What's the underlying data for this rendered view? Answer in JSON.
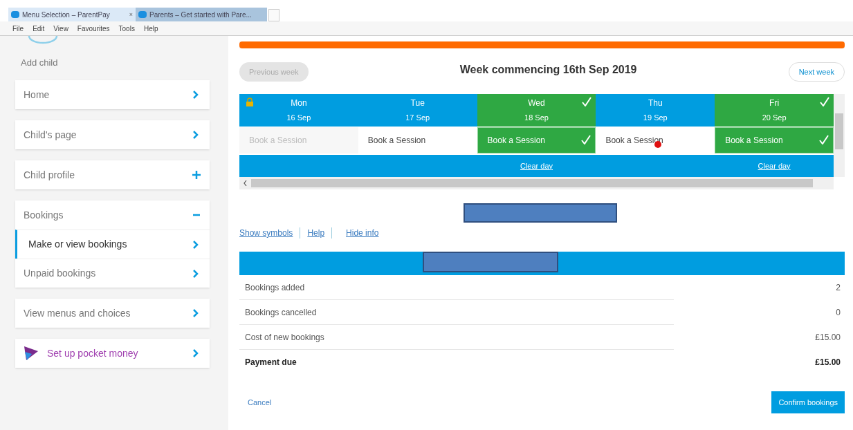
{
  "browser": {
    "tabs": [
      {
        "title": "Menu Selection – ParentPay",
        "selected": true,
        "close": "×"
      },
      {
        "title": "Parents – Get started with Pare...",
        "selected": false
      }
    ],
    "menu": [
      "File",
      "Edit",
      "View",
      "Favourites",
      "Tools",
      "Help"
    ]
  },
  "sidebar": {
    "add_child": "Add child",
    "items": [
      {
        "label": "Home",
        "selected": false
      },
      {
        "label": "Child's page",
        "selected": false
      },
      {
        "label": "Child profile",
        "selected": false,
        "expanded": false
      },
      {
        "label": "Bookings",
        "selected": false,
        "expanded": true,
        "children": [
          {
            "label": "Make or view bookings",
            "selected": true
          },
          {
            "label": "Unpaid bookings",
            "selected": false
          }
        ]
      },
      {
        "label": "View menus and choices",
        "selected": false
      },
      {
        "label": "Set up pocket money",
        "selected": false,
        "kind": "promo"
      }
    ]
  },
  "progress": {
    "level": 1
  },
  "week": {
    "previous": "Previous week",
    "title": "Week commencing 16th Sep 2019",
    "next": "Next week",
    "previous_disabled": true
  },
  "days": [
    {
      "day": "Mon",
      "date": "16 Sep",
      "session": "Book a Session",
      "booked": false,
      "locked": true
    },
    {
      "day": "Tue",
      "date": "17 Sep",
      "session": "Book a Session",
      "booked": false,
      "locked": false
    },
    {
      "day": "Wed",
      "date": "18 Sep",
      "session": "Book a Session",
      "booked": true,
      "locked": false,
      "clear": "Clear day"
    },
    {
      "day": "Thu",
      "date": "19 Sep",
      "session": "Book a Session",
      "booked": false,
      "locked": false
    },
    {
      "day": "Fri",
      "date": "20 Sep",
      "session": "Book a Session",
      "booked": true,
      "locked": false,
      "clear": "Clear day"
    }
  ],
  "links": [
    "Show symbols",
    "Help",
    "Hide info"
  ],
  "summary": [
    {
      "label": "Bookings added",
      "value": "2",
      "bold": false
    },
    {
      "label": "Bookings cancelled",
      "value": "0",
      "bold": false
    },
    {
      "label": "Cost of new bookings",
      "value": "£15.00",
      "bold": false
    },
    {
      "label": "Payment due",
      "value": "£15.00",
      "bold": true
    }
  ],
  "actions": {
    "cancel": "Cancel",
    "confirm": "Confirm bookings"
  }
}
